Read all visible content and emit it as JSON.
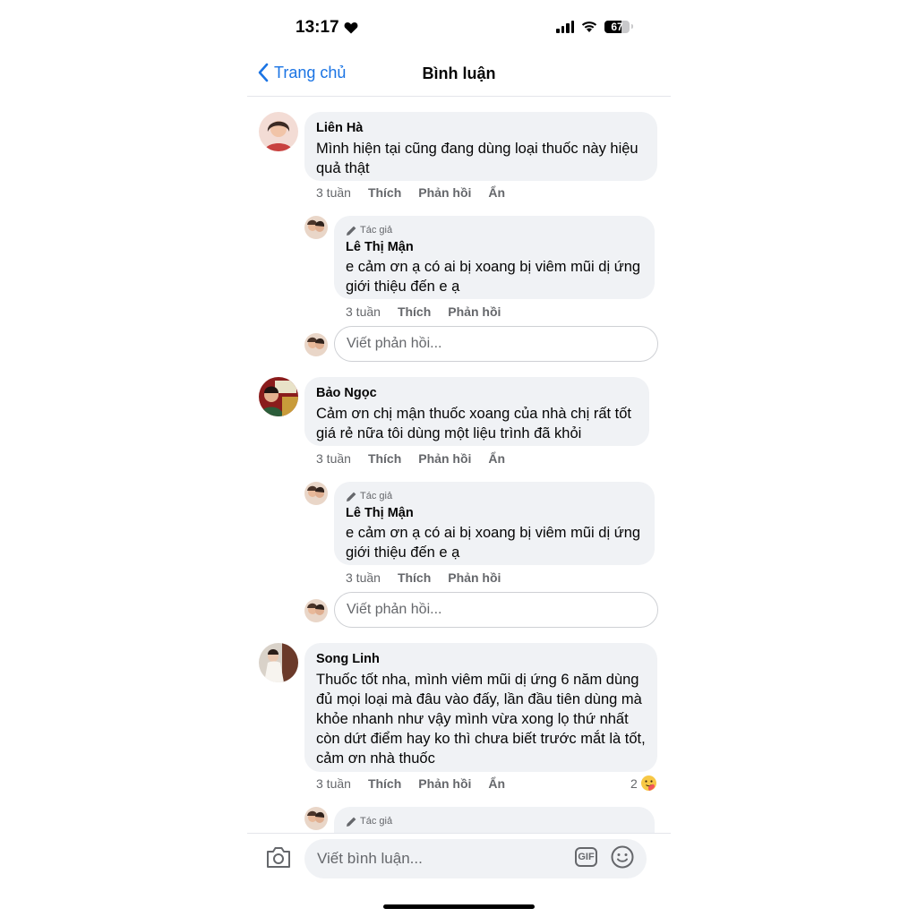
{
  "status_bar": {
    "time": "13:17",
    "battery": "67",
    "battery_level": 0.67
  },
  "header": {
    "back_label": "Trang chủ",
    "title": "Bình luận"
  },
  "comments": [
    {
      "name": "Liên Hà",
      "text": "Mình hiện tại cũng đang dùng loại thuốc này hiệu quả thật",
      "time": "3 tuần",
      "like": "Thích",
      "reply": "Phản hồi",
      "hide": "Ẩn",
      "author_reply": {
        "badge": "Tác giả",
        "name": "Lê Thị Mận",
        "text": "e cảm ơn ạ có ai bị xoang bị viêm mũi dị ứng giới thiệu đến e ạ",
        "time": "3 tuần",
        "like": "Thích",
        "reply": "Phản hồi"
      },
      "reply_placeholder": "Viết phản hồi..."
    },
    {
      "name": "Bảo Ngọc",
      "text": "Cảm ơn chị mận thuốc xoang của nhà chị rất tốt giá rẻ nữa tôi dùng một liệu trình đã khỏi",
      "time": "3 tuần",
      "like": "Thích",
      "reply": "Phản hồi",
      "hide": "Ẩn",
      "author_reply": {
        "badge": "Tác giả",
        "name": "Lê Thị Mận",
        "text": "e cảm ơn ạ có ai bị xoang bị viêm mũi dị ứng giới thiệu đến e ạ",
        "time": "3 tuần",
        "like": "Thích",
        "reply": "Phản hồi"
      },
      "reply_placeholder": "Viết phản hồi..."
    },
    {
      "name": "Song Linh",
      "text": "Thuốc tốt nha, mình viêm mũi dị ứng 6 năm dùng đủ mọi loại mà đâu vào đấy, lần đầu tiên dùng mà khỏe nhanh như vậy mình vừa xong lọ thứ nhất còn dứt điểm hay ko thì chưa biết trước mắt là tốt, cảm ơn nhà thuốc",
      "time": "3 tuần",
      "like": "Thích",
      "reply": "Phản hồi",
      "hide": "Ẩn",
      "reaction_count": "2",
      "author_reply": {
        "badge": "Tác giả"
      }
    }
  ],
  "composer": {
    "placeholder": "Viết bình luận...",
    "gif_label": "GIF"
  },
  "icons": [
    "heart-icon",
    "signal-icon",
    "wifi-icon",
    "battery-icon",
    "chevron-left-icon",
    "pencil-icon",
    "camera-icon",
    "gif-icon",
    "smiley-icon",
    "care-reaction-icon"
  ],
  "colors": {
    "accent": "#1b74e4",
    "bubble": "#f0f2f5",
    "muted": "#65676b"
  }
}
